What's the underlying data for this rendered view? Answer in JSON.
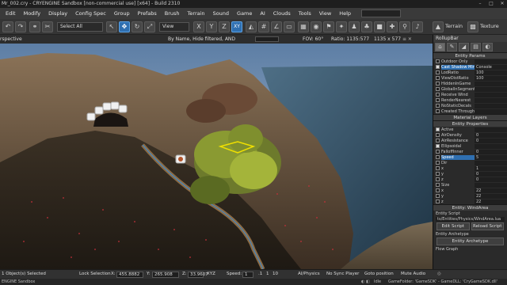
{
  "window": {
    "title": "Mr_002.cry - CRYENGINE Sandbox [non-commercial use] [x64] - Build 2310",
    "minimize": "–",
    "maximize": "□",
    "close": "✕"
  },
  "menu": [
    "Edit",
    "Modify",
    "Display",
    "Config Spec",
    "Group",
    "Prefabs",
    "Brush",
    "Terrain",
    "Sound",
    "Game",
    "AI",
    "Clouds",
    "Tools",
    "View",
    "Help"
  ],
  "toolbar": {
    "select_all": "Select All",
    "view_select": "View",
    "terrain_label": "Terrain",
    "texture_label": "Texture",
    "axis_x": "X",
    "axis_y": "Y",
    "axis_z": "Z",
    "axis_xy": "XY"
  },
  "viewport_header": {
    "name": "rspective",
    "filter": "By Name, Hide filtered, AND",
    "fov": "FOV:  60°",
    "ratio": "Ratio:  1135:577",
    "size": "1135 x 577"
  },
  "rollup": {
    "title": "RollupBar",
    "tabs": [
      "⌂",
      "✎",
      "◢",
      "▤",
      "◐"
    ],
    "entity_params_title": "Entity Params",
    "entity_params": [
      {
        "label": "Outdoor Only",
        "checked": false,
        "value": ""
      },
      {
        "label": "Cast Shadow Min",
        "checked": true,
        "value": "Console",
        "selected": true
      },
      {
        "label": "LodRatio",
        "checked": false,
        "value": "100"
      },
      {
        "label": "ViewDistRatio",
        "checked": false,
        "value": "100"
      },
      {
        "label": "HiddenInGame",
        "checked": false,
        "value": ""
      },
      {
        "label": "GlobalInSegments",
        "checked": false,
        "value": ""
      },
      {
        "label": "Receive Wind",
        "checked": false,
        "value": ""
      },
      {
        "label": "RenderNearest",
        "checked": false,
        "value": ""
      },
      {
        "label": "NoStaticDecals",
        "checked": false,
        "value": ""
      },
      {
        "label": "Created Through",
        "checked": false,
        "value": ""
      }
    ],
    "material_layers_title": "Material Layers",
    "entity_properties_title": "Entity Properties",
    "entity_properties": [
      {
        "label": "Active",
        "checked": true,
        "value": ""
      },
      {
        "label": "AirDensity",
        "checked": false,
        "value": "0"
      },
      {
        "label": "AirResistance",
        "checked": false,
        "value": "0"
      },
      {
        "label": "Ellipsoidal",
        "checked": true,
        "value": ""
      },
      {
        "label": "FalloffInner",
        "checked": false,
        "value": "0"
      },
      {
        "label": "Speed",
        "checked": false,
        "value": "5",
        "selected": true
      },
      {
        "label": "Dir",
        "checked": false,
        "value": ""
      },
      {
        "label": "x",
        "checked": false,
        "value": "1"
      },
      {
        "label": "y",
        "checked": false,
        "value": "0"
      },
      {
        "label": "z",
        "checked": false,
        "value": "0"
      },
      {
        "label": "Size",
        "checked": false,
        "value": ""
      },
      {
        "label": "x",
        "checked": false,
        "value": "22"
      },
      {
        "label": "y",
        "checked": false,
        "value": "22"
      },
      {
        "label": "z",
        "checked": false,
        "value": "22"
      }
    ],
    "entity_wind_title": "Entity: WindArea",
    "entity_script_label": "Entity Script",
    "entity_script_path": "ts/Entities/Physics/WindArea.lua",
    "edit_script": "Edit Script",
    "reload_script": "Reload Script",
    "entity_archetype_label": "Entity Archetype",
    "entity_archetype_btn": "Entity Archetype",
    "flow_graph_label": "Flow Graph"
  },
  "status": {
    "selected": "1 Object(s) Selected",
    "lock_selection": "Lock Selection",
    "x_label": "X:",
    "x_value": "455.8882",
    "y_label": "Y:",
    "y_value": "265.908",
    "z_label": "Z:",
    "z_value": "33.9607",
    "xyz": "XYZ",
    "speed_label": "Speed:",
    "speed_value": "1",
    "speed_01": ".1",
    "speed_1": "1",
    "speed_10": "10",
    "ai_physics": "AI/Physics",
    "no_sync": "No Sync Player",
    "goto_pos": "Goto position",
    "mute_audio": "Mute Audio"
  },
  "bottom": {
    "left": "ENGINE Sandbox",
    "idle": "Idle",
    "game_folder": "GameFolder: 'GameSDK' - GameDLL: 'CryGameSDK.dll'"
  }
}
